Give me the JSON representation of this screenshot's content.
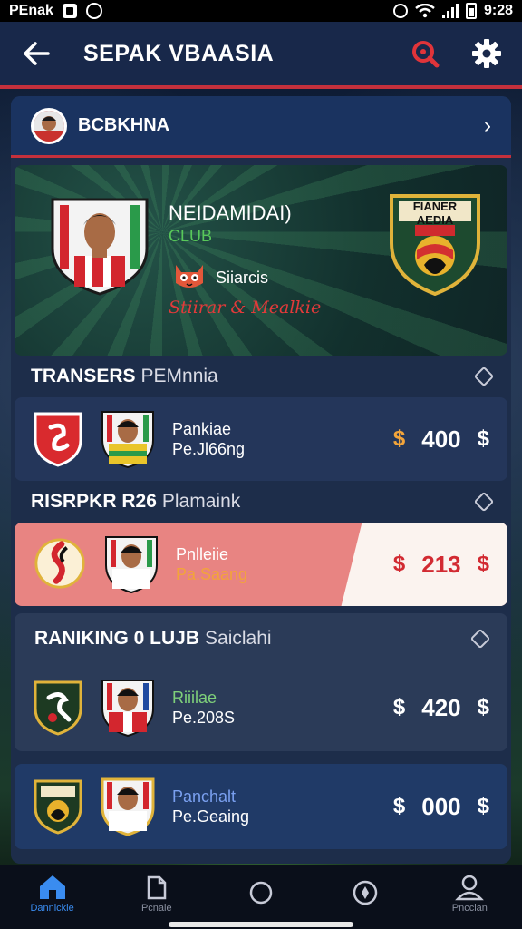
{
  "status_bar": {
    "carrier": "PEnak",
    "time": "9:28"
  },
  "header": {
    "title": "SEPAK VBAASIA",
    "icons": [
      "back-arrow-icon",
      "search-icon",
      "gear-icon"
    ]
  },
  "profile": {
    "name": "BCBKHNA"
  },
  "hero": {
    "player_name": "NEIDAMIDAI)",
    "club": "CLUB",
    "status": "Siiarcis",
    "tagline": "Stiirar & Mealkie",
    "crest_text": "FIANER AEDIA"
  },
  "sections": [
    {
      "title_bold": "TRANSERS",
      "title_light": "PEMnnia",
      "rows": [
        {
          "name": "Pankiae",
          "sub": "Pe.Jl66ng",
          "price": "400"
        }
      ]
    },
    {
      "title_bold": "RISRPKR R26",
      "title_light": "Plamaink",
      "rows": [
        {
          "name": "Pnlleiie",
          "sub": "Pa.Saang",
          "price": "213"
        }
      ]
    },
    {
      "title_bold": "RANIKING 0 LUJB",
      "title_light": "Saiclahi",
      "rows": [
        {
          "name": "Riiilae",
          "sub": "Pe.208S",
          "price": "420"
        },
        {
          "name": "Panchalt",
          "sub": "Pe.Geaing",
          "price": "000"
        }
      ]
    }
  ],
  "currency_symbol": "$",
  "colors": {
    "accent_red": "#c4303c",
    "header_bg": "#18284a",
    "highlight_row": "#e88482",
    "club_green": "#58c85a",
    "nav_active": "#3a8cf0"
  },
  "bottom_nav": [
    {
      "label": "Dannickie",
      "icon": "home-icon"
    },
    {
      "label": "Pcnale",
      "icon": "card-icon"
    },
    {
      "label": "",
      "icon": "circle-icon"
    },
    {
      "label": "",
      "icon": "shield-icon"
    },
    {
      "label": "Pncclan",
      "icon": "profile-icon"
    }
  ]
}
